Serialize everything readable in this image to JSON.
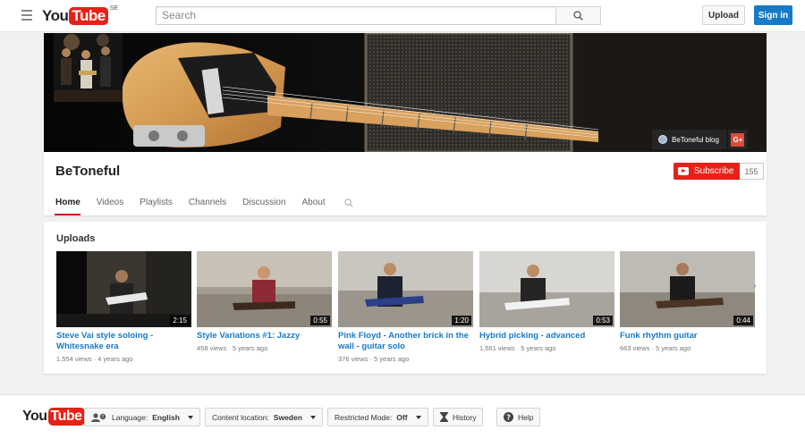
{
  "masthead": {
    "logo_you": "You",
    "logo_tube": "Tube",
    "country_code": "SE",
    "search_placeholder": "Search",
    "upload_label": "Upload",
    "signin_label": "Sign in"
  },
  "banner": {
    "blog_link": "BeToneful blog",
    "gplus_label": "G+"
  },
  "channel": {
    "name": "BeToneful",
    "subscribe_label": "Subscribe",
    "subscriber_count": "155",
    "tabs": [
      {
        "label": "Home",
        "active": true
      },
      {
        "label": "Videos"
      },
      {
        "label": "Playlists"
      },
      {
        "label": "Channels"
      },
      {
        "label": "Discussion"
      },
      {
        "label": "About"
      }
    ]
  },
  "uploads": {
    "heading": "Uploads",
    "videos": [
      {
        "title": "Steve Vai style soloing - Whitesnake era",
        "views": "1,554 views",
        "age": "4 years ago",
        "duration": "2:15"
      },
      {
        "title": "Style Variations #1: Jazzy",
        "views": "458 views",
        "age": "5 years ago",
        "duration": "0:55"
      },
      {
        "title": "Pink Floyd - Another brick in the wall - guitar solo",
        "views": "376 views",
        "age": "5 years ago",
        "duration": "1:20"
      },
      {
        "title": "Hybrid picking - advanced",
        "views": "1,561 views",
        "age": "5 years ago",
        "duration": "0:53"
      },
      {
        "title": "Funk rhythm guitar",
        "views": "663 views",
        "age": "5 years ago",
        "duration": "0:44"
      }
    ],
    "meta_separator": "·",
    "next_arrow": "›"
  },
  "footer": {
    "language_label": "Language:",
    "language_value": "English",
    "location_label": "Content location:",
    "location_value": "Sweden",
    "restricted_label": "Restricted Mode:",
    "restricted_value": "Off",
    "history_label": "History",
    "help_label": "Help"
  },
  "colors": {
    "brand_red": "#e62117",
    "link_blue": "#167ac6",
    "signin_blue": "#167ac6"
  }
}
